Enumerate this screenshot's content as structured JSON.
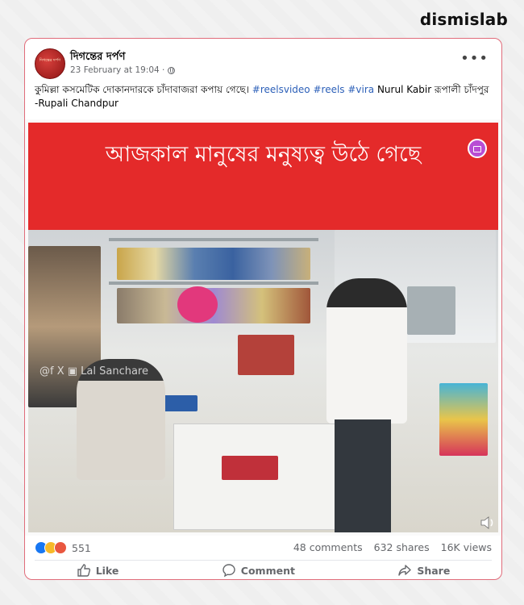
{
  "brand": "dismislab",
  "post": {
    "page_name": "দিগন্তের দর্পণ",
    "avatar_text": "দিগন্তের দর্পণ",
    "timestamp": "23 February at 19:04 ·",
    "caption_text": "কুমিল্লা কসমেটিক দোকানদারকে চাঁদাবাজরা কপায় গেছে। ",
    "caption_tags": "#reelsvideo #reels #vira",
    "caption_tail": " Nurul Kabir রূপালী চাঁদপুর -Rupali Chandpur",
    "more_label": "•••"
  },
  "video": {
    "banner_text": "আজকাল মানুষের মনুষ্যত্ব উঠে গেছে",
    "watermark": "@f X ▣ Lal Sanchare"
  },
  "stats": {
    "reaction_count": "551",
    "comments": "48 comments",
    "shares": "632 shares",
    "views": "16K views",
    "reaction_colors": [
      "#1877f2",
      "#f7b928",
      "#e9573f"
    ]
  },
  "actions": {
    "like": "Like",
    "comment": "Comment",
    "share": "Share"
  }
}
